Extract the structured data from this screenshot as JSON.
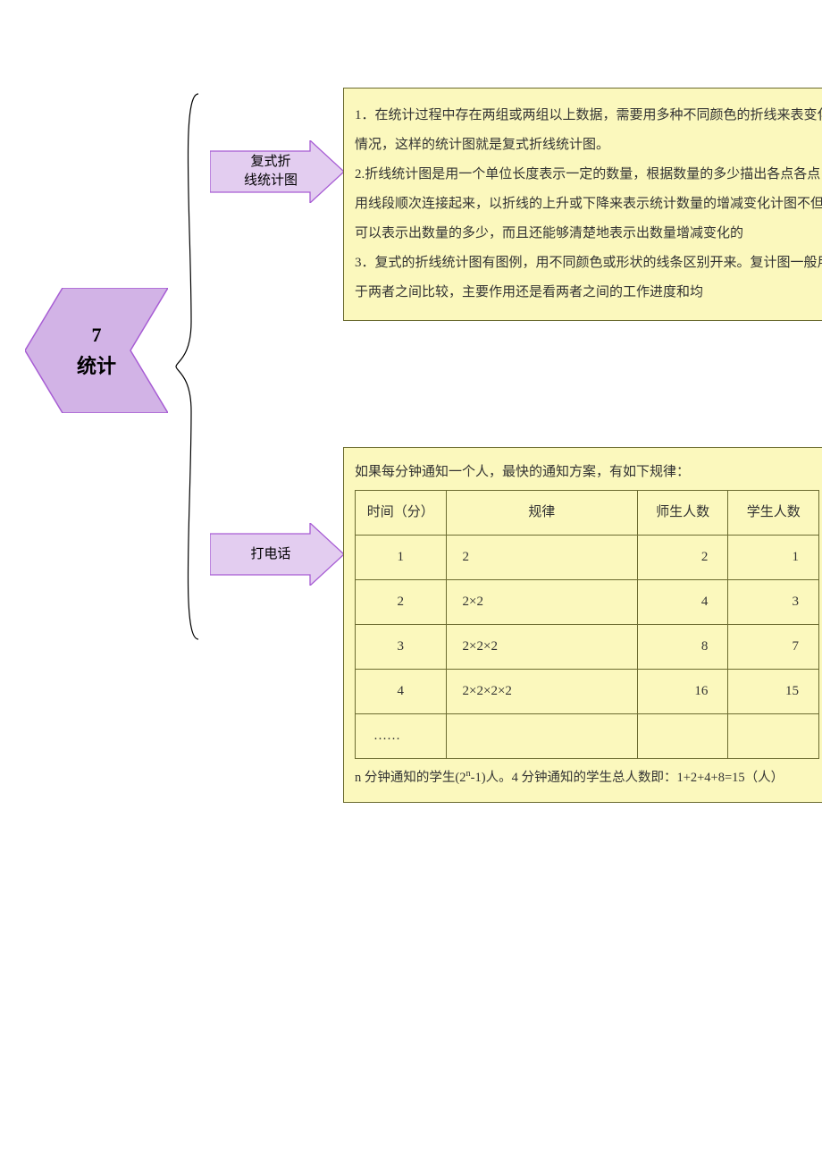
{
  "main": {
    "label1": "7",
    "label2": "统计",
    "branch1_label": "复式折\n线统计图",
    "branch2_label": "打电话"
  },
  "box1": {
    "p1": "1．在统计过程中存在两组或两组以上数据，需要用多种不同颜色的折线来表变化情况，这样的统计图就是复式折线统计图。",
    "p2": "2.折线统计图是用一个单位长度表示一定的数量，根据数量的多少描出各点各点用线段顺次连接起来，以折线的上升或下降来表示统计数量的增减变化计图不但可以表示出数量的多少，而且还能够清楚地表示出数量增减变化的",
    "p3": "3．复式的折线统计图有图例，用不同颜色或形状的线条区别开来。复计图一般用于两者之间比较，主要作用还是看两者之间的工作进度和均"
  },
  "box2": {
    "title": "如果每分钟通知一个人，最快的通知方案，有如下规律：",
    "headers": {
      "c1": "时间（分）",
      "c2": "规律",
      "c3": "师生人数",
      "c4": "学生人数"
    },
    "rows": [
      {
        "t": "1",
        "r": "2",
        "a": "2",
        "b": "1"
      },
      {
        "t": "2",
        "r": "2×2",
        "a": "4",
        "b": "3"
      },
      {
        "t": "3",
        "r": "2×2×2",
        "a": "8",
        "b": "7"
      },
      {
        "t": "4",
        "r": "2×2×2×2",
        "a": "16",
        "b": "15"
      },
      {
        "t": "……",
        "r": "",
        "a": "",
        "b": ""
      }
    ],
    "note_pre": "n 分钟通知的学生(2",
    "note_sup": "n",
    "note_post": "-1)人。4 分钟通知的学生总人数即：1+2+4+8=15（人）"
  },
  "colors": {
    "hex_fill": "#d2b3e6",
    "hex_stroke": "#a75dd4",
    "arrow_fill": "#e3cdf0",
    "arrow_stroke": "#a75dd4",
    "box_fill": "#fbf8bd",
    "box_border": "#6b6b30"
  }
}
